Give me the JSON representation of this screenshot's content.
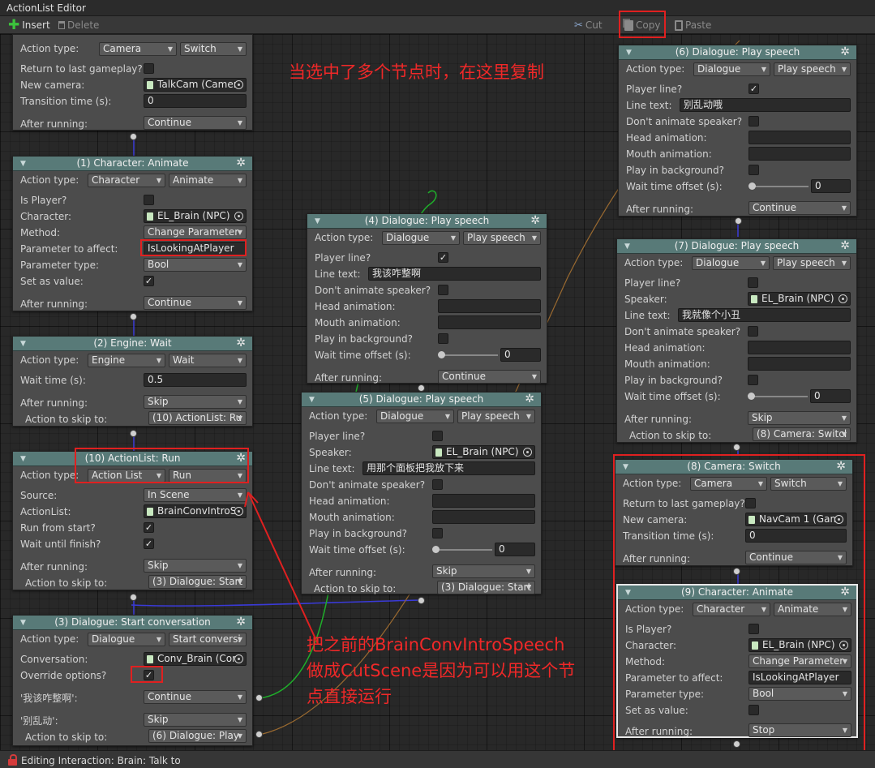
{
  "window": {
    "title": "ActionList Editor"
  },
  "toolbar": {
    "insert": "Insert",
    "delete": "Delete",
    "cut": "Cut",
    "copy": "Copy",
    "paste": "Paste"
  },
  "nodes": {
    "n0": {
      "action_type_label": "Action type:",
      "category": "Camera",
      "action": "Switch",
      "return_label": "Return to last gameplay?",
      "new_camera_label": "New camera:",
      "new_camera": "TalkCam (Camer",
      "transition_label": "Transition time (s):",
      "transition": "0",
      "after_label": "After running:",
      "after": "Continue"
    },
    "n1": {
      "title": "(1) Character: Animate",
      "action_type_label": "Action type:",
      "category": "Character",
      "action": "Animate",
      "is_player_label": "Is Player?",
      "character_label": "Character:",
      "character": "EL_Brain (NPC)",
      "method_label": "Method:",
      "method": "Change Parameter",
      "param_label": "Parameter to affect:",
      "param": "IsLookingAtPlayer",
      "param_type_label": "Parameter type:",
      "param_type": "Bool",
      "set_value_label": "Set as value:",
      "after_label": "After running:",
      "after": "Continue"
    },
    "n2": {
      "title": "(2) Engine: Wait",
      "action_type_label": "Action type:",
      "category": "Engine",
      "action": "Wait",
      "wait_label": "Wait time (s):",
      "wait": "0.5",
      "after_label": "After running:",
      "after": "Skip",
      "skip_label": "Action to skip to:",
      "skip": "(10) ActionList: Ru"
    },
    "n10": {
      "title": "(10) ActionList: Run",
      "action_type_label": "Action type:",
      "category": "Action List",
      "action": "Run",
      "source_label": "Source:",
      "source": "In Scene",
      "actionlist_label": "ActionList:",
      "actionlist": "BrainConvIntroS",
      "run_start_label": "Run from start?",
      "wait_finish_label": "Wait until finish?",
      "after_label": "After running:",
      "after": "Skip",
      "skip_label": "Action to skip to:",
      "skip": "(3) Dialogue: Start"
    },
    "n3": {
      "title": "(3) Dialogue: Start conversation",
      "action_type_label": "Action type:",
      "category": "Dialogue",
      "action": "Start conversi",
      "conversation_label": "Conversation:",
      "conversation": "Conv_Brain (Con",
      "override_label": "Override options?",
      "opt1_label": "'我该咋整啊':",
      "opt1": "Continue",
      "opt2_label": "'别乱动':",
      "opt2": "Skip",
      "skip_label": "Action to skip to:",
      "skip": "(6) Dialogue: Play"
    },
    "n4": {
      "title": "(4) Dialogue: Play speech",
      "action_type_label": "Action type:",
      "category": "Dialogue",
      "action": "Play speech",
      "player_line_label": "Player line?",
      "line_label": "Line text:",
      "line": "我该咋整啊",
      "dont_animate_label": "Don't animate speaker?",
      "head_label": "Head animation:",
      "mouth_label": "Mouth animation:",
      "bg_label": "Play in background?",
      "offset_label": "Wait time offset (s):",
      "offset": "0",
      "after_label": "After running:",
      "after": "Continue"
    },
    "n5": {
      "title": "(5) Dialogue: Play speech",
      "action_type_label": "Action type:",
      "category": "Dialogue",
      "action": "Play speech",
      "player_line_label": "Player line?",
      "speaker_label": "Speaker:",
      "speaker": "EL_Brain (NPC)",
      "line_label": "Line text:",
      "line": "用那个面板把我放下来",
      "dont_animate_label": "Don't animate speaker?",
      "head_label": "Head animation:",
      "mouth_label": "Mouth animation:",
      "bg_label": "Play in background?",
      "offset_label": "Wait time offset (s):",
      "offset": "0",
      "after_label": "After running:",
      "after": "Skip",
      "skip_label": "Action to skip to:",
      "skip": "(3) Dialogue: Start"
    },
    "n6": {
      "title": "(6) Dialogue: Play speech",
      "action_type_label": "Action type:",
      "category": "Dialogue",
      "action": "Play speech",
      "player_line_label": "Player line?",
      "line_label": "Line text:",
      "line": "别乱动哦",
      "dont_animate_label": "Don't animate speaker?",
      "head_label": "Head animation:",
      "mouth_label": "Mouth animation:",
      "bg_label": "Play in background?",
      "offset_label": "Wait time offset (s):",
      "offset": "0",
      "after_label": "After running:",
      "after": "Continue"
    },
    "n7": {
      "title": "(7) Dialogue: Play speech",
      "action_type_label": "Action type:",
      "category": "Dialogue",
      "action": "Play speech",
      "player_line_label": "Player line?",
      "speaker_label": "Speaker:",
      "speaker": "EL_Brain (NPC)",
      "line_label": "Line text:",
      "line": "我就像个小丑",
      "dont_animate_label": "Don't animate speaker?",
      "head_label": "Head animation:",
      "mouth_label": "Mouth animation:",
      "bg_label": "Play in background?",
      "offset_label": "Wait time offset (s):",
      "offset": "0",
      "after_label": "After running:",
      "after": "Skip",
      "skip_label": "Action to skip to:",
      "skip": "(8) Camera: Switcl"
    },
    "n8": {
      "title": "(8) Camera: Switch",
      "action_type_label": "Action type:",
      "category": "Camera",
      "action": "Switch",
      "return_label": "Return to last gameplay?",
      "new_camera_label": "New camera:",
      "new_camera": "NavCam 1 (Gam",
      "transition_label": "Transition time (s):",
      "transition": "0",
      "after_label": "After running:",
      "after": "Continue"
    },
    "n9": {
      "title": "(9) Character: Animate",
      "action_type_label": "Action type:",
      "category": "Character",
      "action": "Animate",
      "is_player_label": "Is Player?",
      "character_label": "Character:",
      "character": "EL_Brain (NPC)",
      "method_label": "Method:",
      "method": "Change Parameter",
      "param_label": "Parameter to affect:",
      "param": "IsLookingAtPlayer",
      "param_type_label": "Parameter type:",
      "param_type": "Bool",
      "set_value_label": "Set as value:",
      "after_label": "After running:",
      "after": "Stop"
    }
  },
  "annotations": {
    "copy_note": "当选中了多个节点时，在这里复制",
    "cutscene_note_1": "把之前的BrainConvIntroSpeech",
    "cutscene_note_2": "做成CutScene是因为可以用这个节",
    "cutscene_note_3": "点直接运行"
  },
  "status": {
    "text": "Editing Interaction: Brain: Talk to"
  },
  "colors": {
    "header": "#587a78",
    "annotation": "#e02020",
    "node_body": "#4c4c4c",
    "wire_skip": "#3a3ad8",
    "wire_continue": "#1fae2a"
  }
}
